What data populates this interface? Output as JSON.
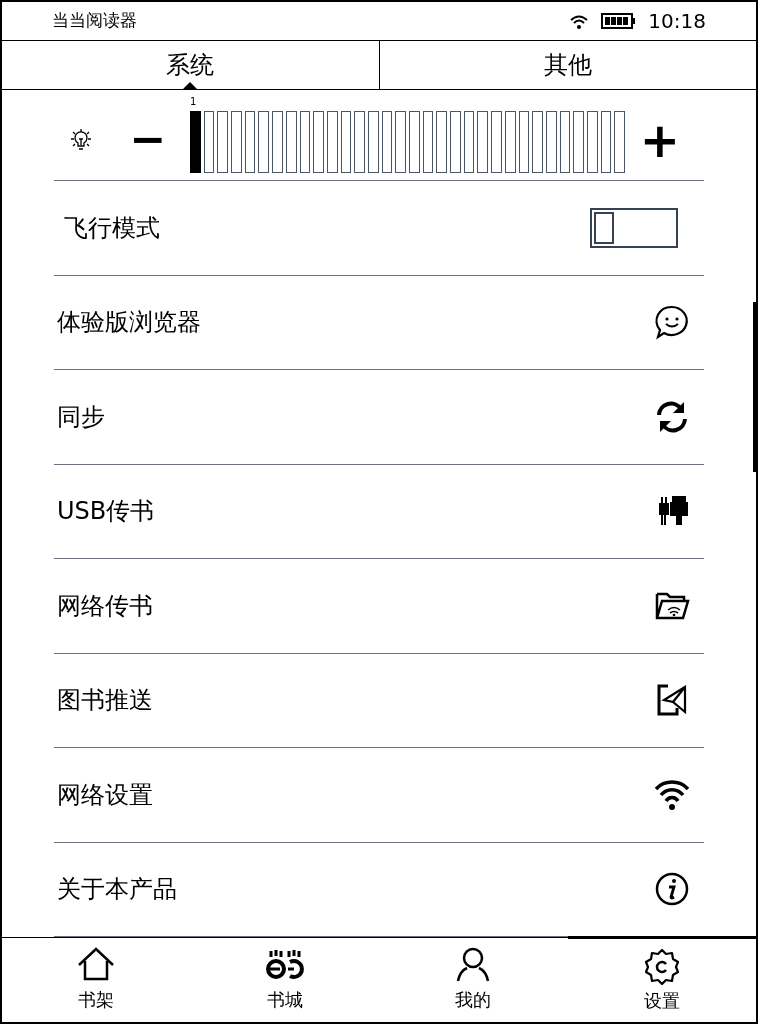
{
  "status_bar": {
    "title": "当当阅读器",
    "time": "10:18"
  },
  "tabs": [
    {
      "label": "系统",
      "selected": true
    },
    {
      "label": "其他",
      "selected": false
    }
  ],
  "brightness": {
    "reading": "1",
    "level": 0.03125,
    "minus": "−",
    "plus": "+"
  },
  "settings": [
    {
      "kind": "toggle",
      "label": "飞行模式",
      "on": false
    },
    {
      "kind": "link",
      "label": "体验版浏览器"
    },
    {
      "kind": "link",
      "label": "同步"
    },
    {
      "kind": "link",
      "label": "USB传书"
    },
    {
      "kind": "link",
      "label": "网络传书"
    },
    {
      "kind": "link",
      "label": "图书推送"
    },
    {
      "kind": "link",
      "label": "网络设置"
    },
    {
      "kind": "link",
      "label": "关于本产品"
    }
  ],
  "bottom_nav": [
    {
      "label": "书架",
      "selected": false
    },
    {
      "label": "书城",
      "selected": false
    },
    {
      "label": "我的",
      "selected": false
    },
    {
      "label": "设置",
      "selected": true
    }
  ]
}
